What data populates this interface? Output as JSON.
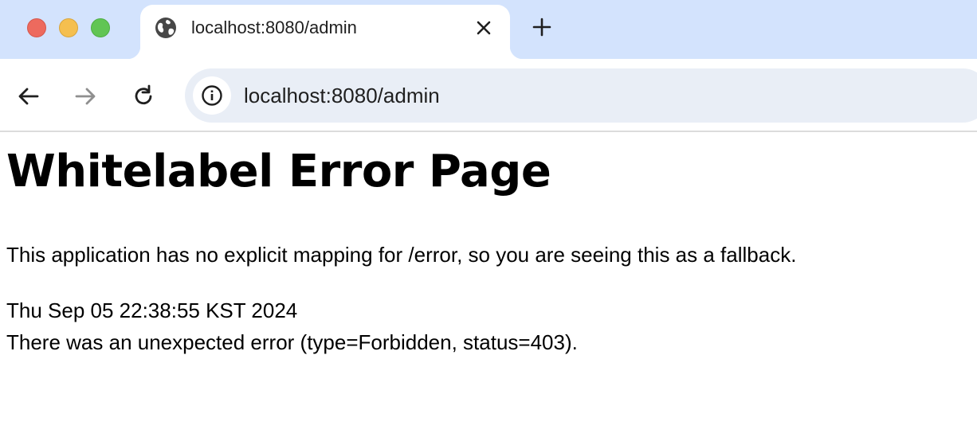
{
  "window": {
    "controls": [
      "close",
      "minimize",
      "zoom"
    ],
    "colors": {
      "close": "#ed6a5e",
      "minimize": "#f5bf4f",
      "zoom": "#61c554",
      "tabstrip": "#d3e3fd",
      "omnibox": "#e9eef6"
    }
  },
  "tab": {
    "title": "localhost:8080/admin",
    "favicon": "globe-icon",
    "close_icon": "close-icon"
  },
  "new_tab_icon": "plus-icon",
  "toolbar": {
    "back_icon": "arrow-left-icon",
    "forward_icon": "arrow-right-icon",
    "reload_icon": "reload-icon",
    "site_info_icon": "info-icon",
    "url": "localhost:8080/admin"
  },
  "page": {
    "heading": "Whitelabel Error Page",
    "message": "This application has no explicit mapping for /error, so you are seeing this as a fallback.",
    "timestamp": "Thu Sep 05 22:38:55 KST 2024",
    "error": "There was an unexpected error (type=Forbidden, status=403)."
  }
}
